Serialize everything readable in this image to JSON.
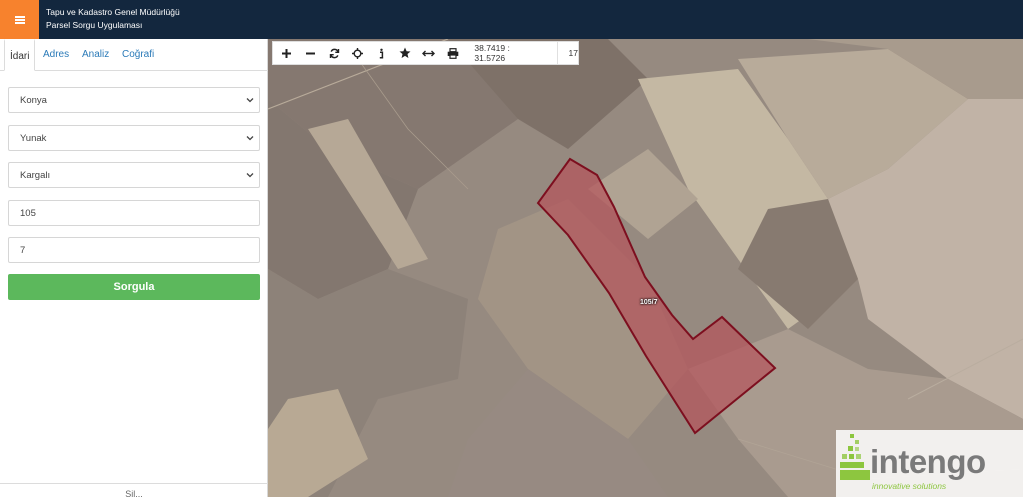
{
  "header": {
    "title": "Tapu ve Kadastro Genel Müdürlüğü",
    "subtitle": "Parsel Sorgu Uygulaması"
  },
  "sidebar": {
    "tabs": [
      {
        "label": "İdari"
      },
      {
        "label": "Adres"
      },
      {
        "label": "Analiz"
      },
      {
        "label": "Coğrafi"
      }
    ],
    "province": "Konya",
    "district": "Yunak",
    "neighborhood": "Kargalı",
    "block": "105",
    "parcel": "7",
    "submit_label": "Sorgula",
    "footer_text": "Sil..."
  },
  "map": {
    "coordinates": "38.7419 : 31.5726",
    "zoom": "17",
    "parcel_label": "105/7",
    "parcel_fill": "#b5525a",
    "parcel_stroke": "#7d0f1f"
  },
  "watermark": {
    "brand": "intengo",
    "tagline": "innovative solutions"
  }
}
